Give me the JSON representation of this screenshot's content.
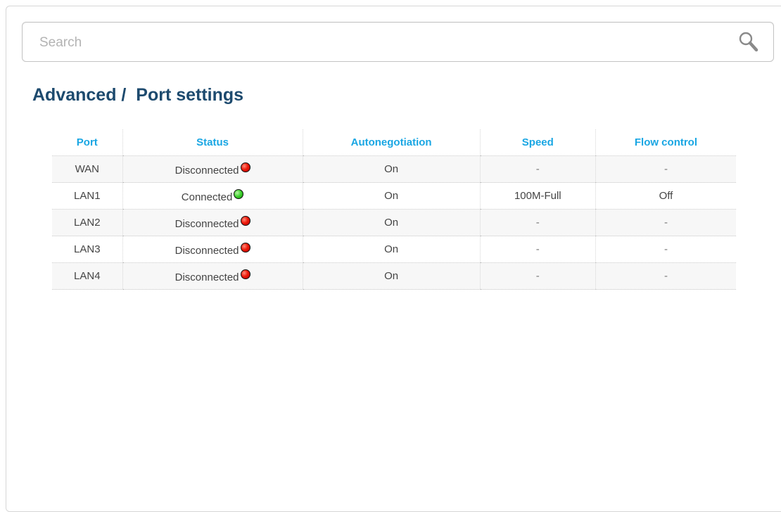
{
  "search": {
    "placeholder": "Search",
    "value": "",
    "icon": "search-icon"
  },
  "page": {
    "title": "Advanced /  Port settings"
  },
  "table": {
    "headers": {
      "port": "Port",
      "status": "Status",
      "autonegotiation": "Autonegotiation",
      "speed": "Speed",
      "flow_control": "Flow control"
    },
    "rows": [
      {
        "port": "WAN",
        "status": "Disconnected",
        "status_state": "red",
        "autonegotiation": "On",
        "speed": "-",
        "flow_control": "-"
      },
      {
        "port": "LAN1",
        "status": "Connected",
        "status_state": "green",
        "autonegotiation": "On",
        "speed": "100M-Full",
        "flow_control": "Off"
      },
      {
        "port": "LAN2",
        "status": "Disconnected",
        "status_state": "red",
        "autonegotiation": "On",
        "speed": "-",
        "flow_control": "-"
      },
      {
        "port": "LAN3",
        "status": "Disconnected",
        "status_state": "red",
        "autonegotiation": "On",
        "speed": "-",
        "flow_control": "-"
      },
      {
        "port": "LAN4",
        "status": "Disconnected",
        "status_state": "red",
        "autonegotiation": "On",
        "speed": "-",
        "flow_control": "-"
      }
    ]
  },
  "colors": {
    "title": "#1d4a6e",
    "header_text": "#19a6e3",
    "status_red": "#ee1a0a",
    "status_green": "#3bcf2a"
  }
}
